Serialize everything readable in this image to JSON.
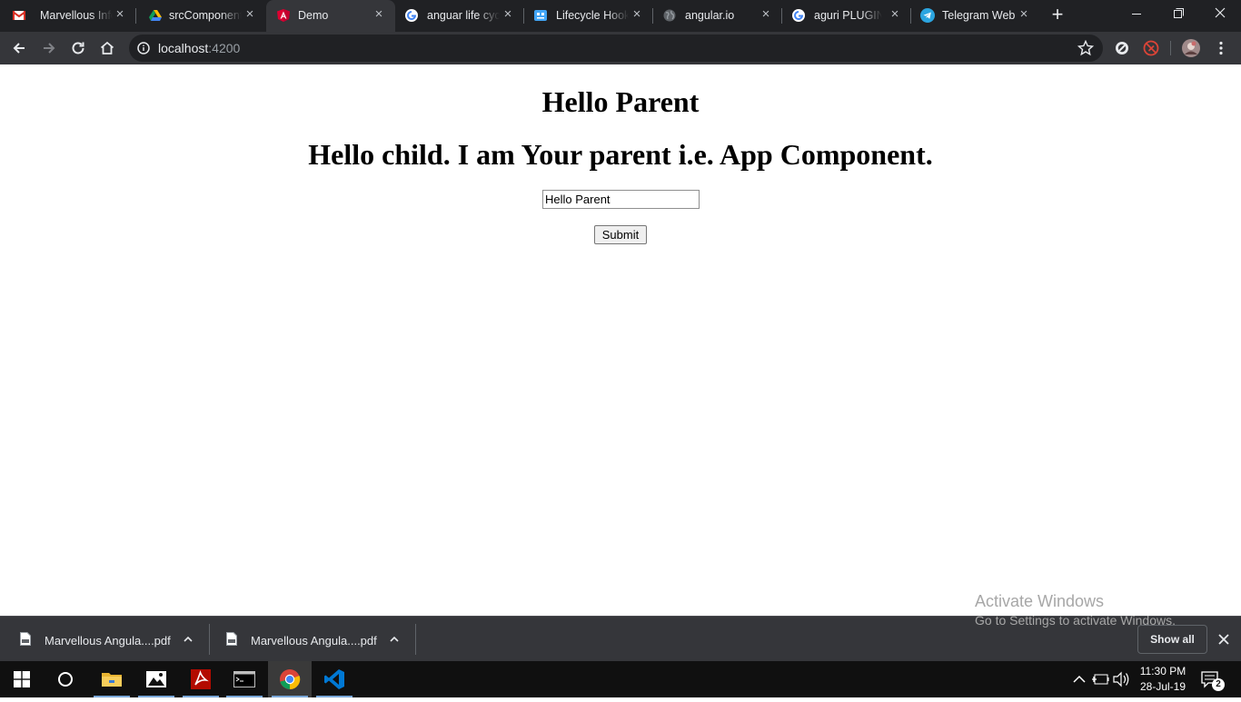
{
  "browser": {
    "tabs": [
      {
        "title": "Marvellous Infos",
        "icon": "gmail-icon"
      },
      {
        "title": "srcComponents",
        "icon": "google-drive-icon"
      },
      {
        "title": "Demo",
        "icon": "angular-icon",
        "active": true
      },
      {
        "title": "anguar life cycle",
        "icon": "google-icon"
      },
      {
        "title": "Lifecycle Hooks",
        "icon": "docs-robot-icon"
      },
      {
        "title": "angular.io",
        "icon": "globe-icon"
      },
      {
        "title": "aguri PLUGIN",
        "icon": "google-icon"
      },
      {
        "title": "Telegram Web",
        "icon": "telegram-icon"
      }
    ],
    "address": {
      "host": "localhost",
      "port": ":4200"
    }
  },
  "page": {
    "heading": "Hello Parent",
    "subheading": "Hello child. I am Your parent i.e. App Component.",
    "input_value": "Hello Parent",
    "submit_label": "Submit"
  },
  "watermark": {
    "line1": "Activate Windows",
    "line2": "Go to Settings to activate Windows."
  },
  "downloads": {
    "items": [
      {
        "name": "Marvellous Angula....pdf"
      },
      {
        "name": "Marvellous Angula....pdf"
      }
    ],
    "show_all_label": "Show all"
  },
  "taskbar": {
    "time": "11:30 PM",
    "date": "28-Jul-19",
    "notification_count": "2"
  },
  "colors": {
    "tab_strip": "#202124",
    "toolbar": "#35363a",
    "taskbar": "#101010",
    "vscode_blue": "#0078d4",
    "chrome_red": "#db4437"
  }
}
